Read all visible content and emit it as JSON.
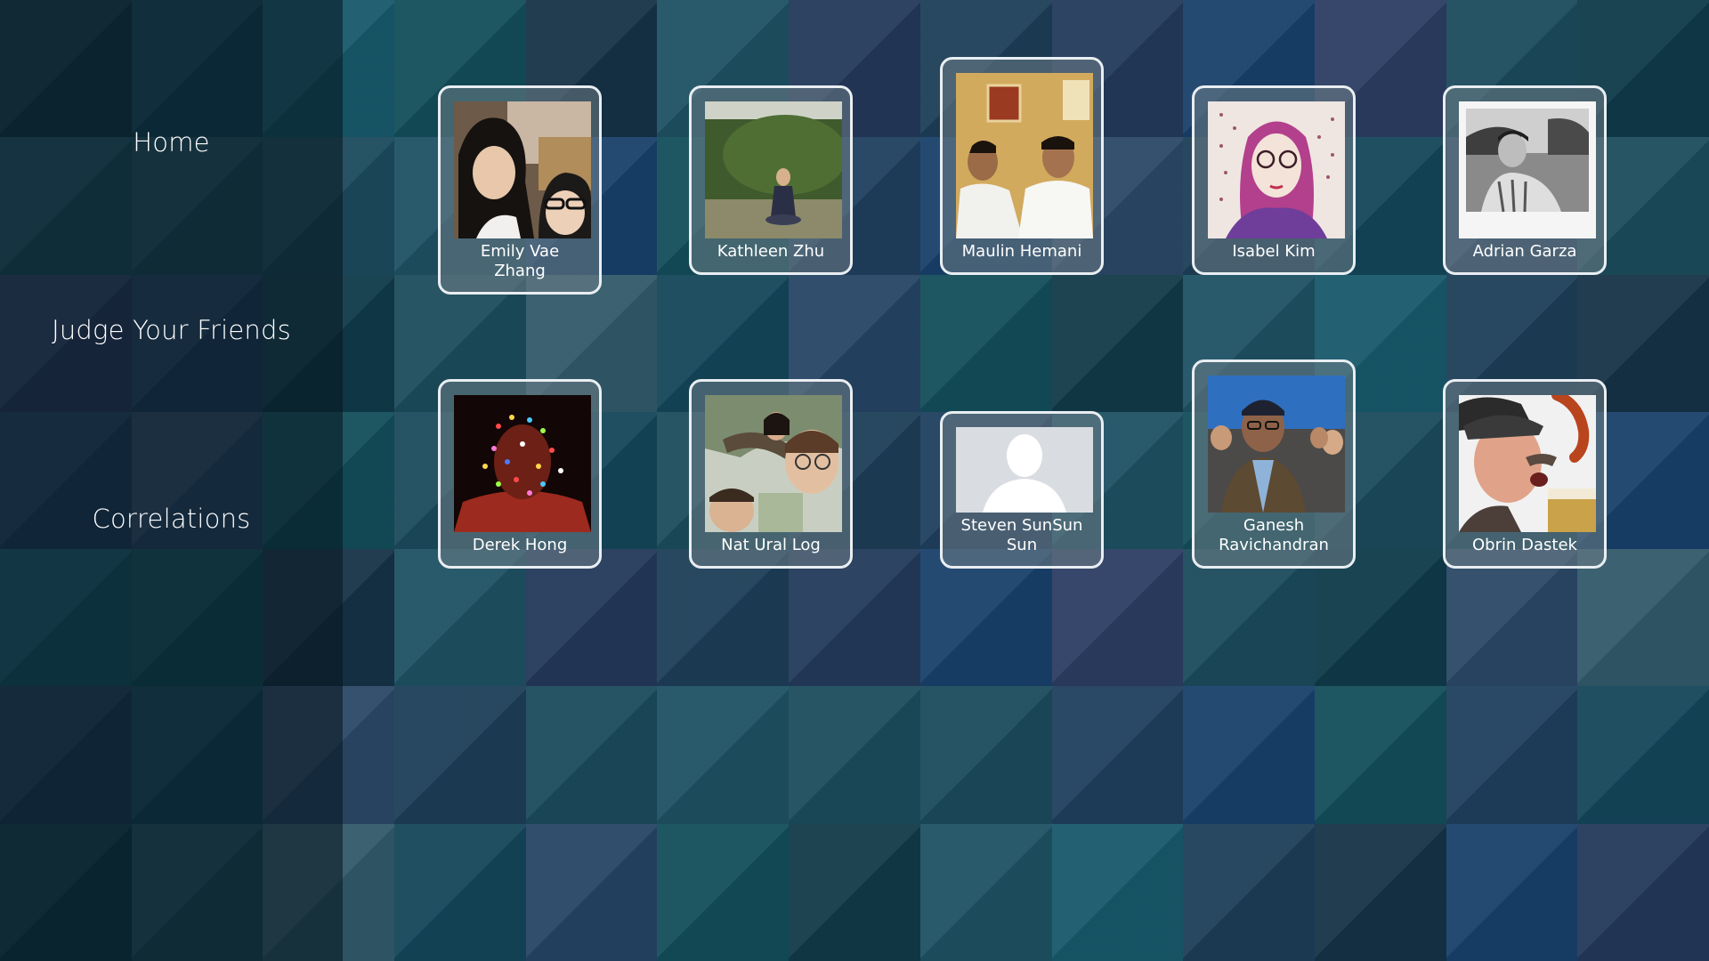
{
  "nav": {
    "items": [
      {
        "label": "Home"
      },
      {
        "label": "Judge Your Friends"
      },
      {
        "label": "Correlations"
      }
    ]
  },
  "friends": [
    {
      "name": "Emily Vae Zhang"
    },
    {
      "name": "Kathleen Zhu"
    },
    {
      "name": "Maulin Hemani"
    },
    {
      "name": "Isabel Kim"
    },
    {
      "name": "Adrian Garza"
    },
    {
      "name": "Derek Hong"
    },
    {
      "name": "Nat Ural Log"
    },
    {
      "name": "Steven SunSun Sun"
    },
    {
      "name": "Ganesh Ravichandran"
    },
    {
      "name": "Obrin Dastek"
    }
  ],
  "colors": {
    "card_border": "#e9eef2",
    "text": "#ffffff",
    "sidebar_bg": "#0b1e2a"
  }
}
